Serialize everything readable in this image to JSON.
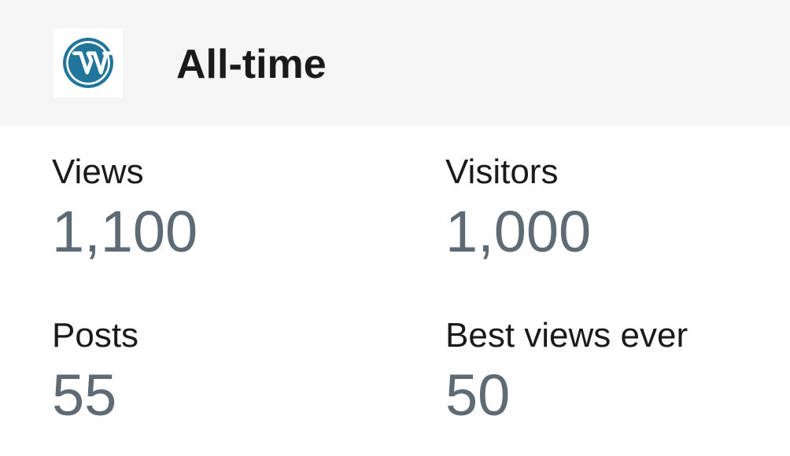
{
  "header": {
    "logo_icon": "wordpress-logo-icon",
    "logo_color": "#21759b",
    "title": "All-time"
  },
  "stats": [
    {
      "label": "Views",
      "value": "1,100"
    },
    {
      "label": "Visitors",
      "value": "1,000"
    },
    {
      "label": "Posts",
      "value": "55"
    },
    {
      "label": "Best views ever",
      "value": "50"
    }
  ],
  "colors": {
    "header_background": "#f5f5f5",
    "label_text": "#1a1a1a",
    "value_text": "#5e6a74"
  }
}
